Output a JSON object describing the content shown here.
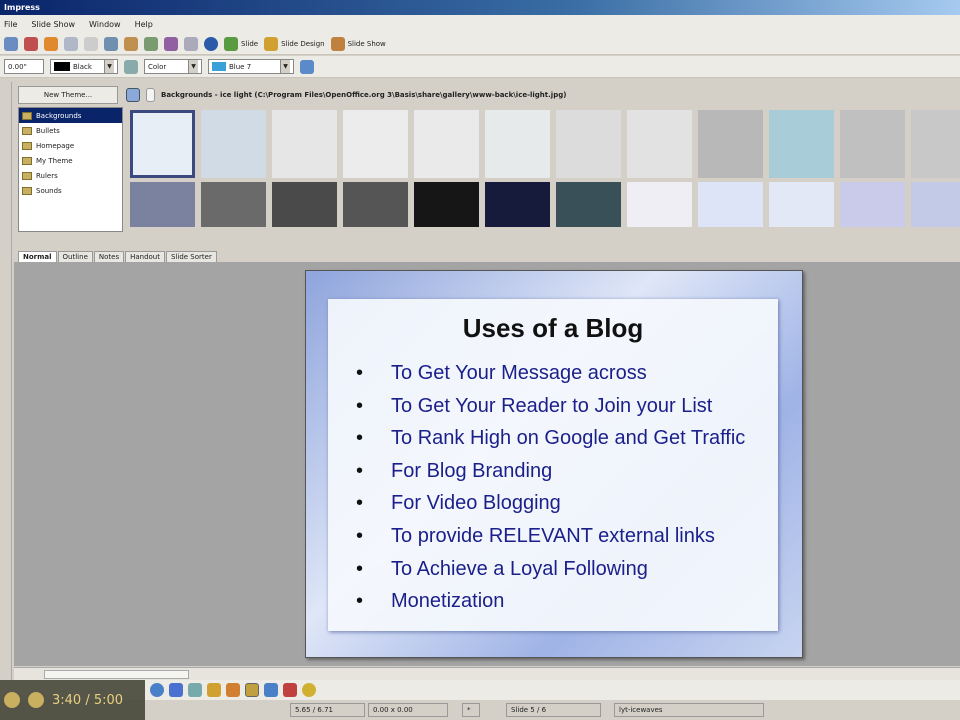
{
  "window": {
    "title": "Impress"
  },
  "menu": [
    "File",
    "Slide Show",
    "Window",
    "Help"
  ],
  "toolbar": {
    "slide_label": "Slide",
    "slide_design_label": "Slide Design",
    "slide_show_label": "Slide Show"
  },
  "format_bar": {
    "line_width": "0.00\"",
    "line_color": "Black",
    "area_style": "Color",
    "area_color": "Blue 7"
  },
  "gallery": {
    "new_theme_label": "New Theme...",
    "header": "Backgrounds - ice light (C:\\Program Files\\OpenOffice.org 3\\Basis\\share\\gallery\\www-back\\ice-light.jpg)",
    "themes": [
      "Backgrounds",
      "Bullets",
      "Homepage",
      "My Theme",
      "Rulers",
      "Sounds"
    ],
    "thumb_colors_row1": [
      "#e8eef5",
      "#d0dbe6",
      "#e6e6e6",
      "#ececec",
      "#eaeaea",
      "#e6eaea",
      "#dcdcdc",
      "#e2e2e2",
      "#b8b8b8",
      "#a8ccd8",
      "#c0c0c0",
      "#c8c8c8"
    ],
    "thumb_colors_row2": [
      "#7a82a0",
      "#6a6a6a",
      "#4a4a4a",
      "#555555",
      "#161616",
      "#161b3c",
      "#3a5058",
      "#eeeef4",
      "#dde4f8",
      "#e2e8f6",
      "#cacaea",
      "#c2cae8"
    ]
  },
  "view_tabs": [
    "Normal",
    "Outline",
    "Notes",
    "Handout",
    "Slide Sorter"
  ],
  "slide": {
    "title": "Uses of a Blog",
    "bullets": [
      "To Get Your Message across",
      "To Get Your Reader to Join your List",
      "To Rank High on Google and Get Traffic",
      "For Blog Branding",
      "For Video Blogging",
      "To provide RELEVANT external links",
      "To Achieve a Loyal Following",
      "Monetization"
    ]
  },
  "video": {
    "time": "3:40 / 5:00"
  },
  "status": {
    "position": "5.65 / 6.71",
    "size": "0.00 x 0.00",
    "modified": "*",
    "slide": "Slide 5 / 6",
    "layout": "lyt-icewaves"
  }
}
